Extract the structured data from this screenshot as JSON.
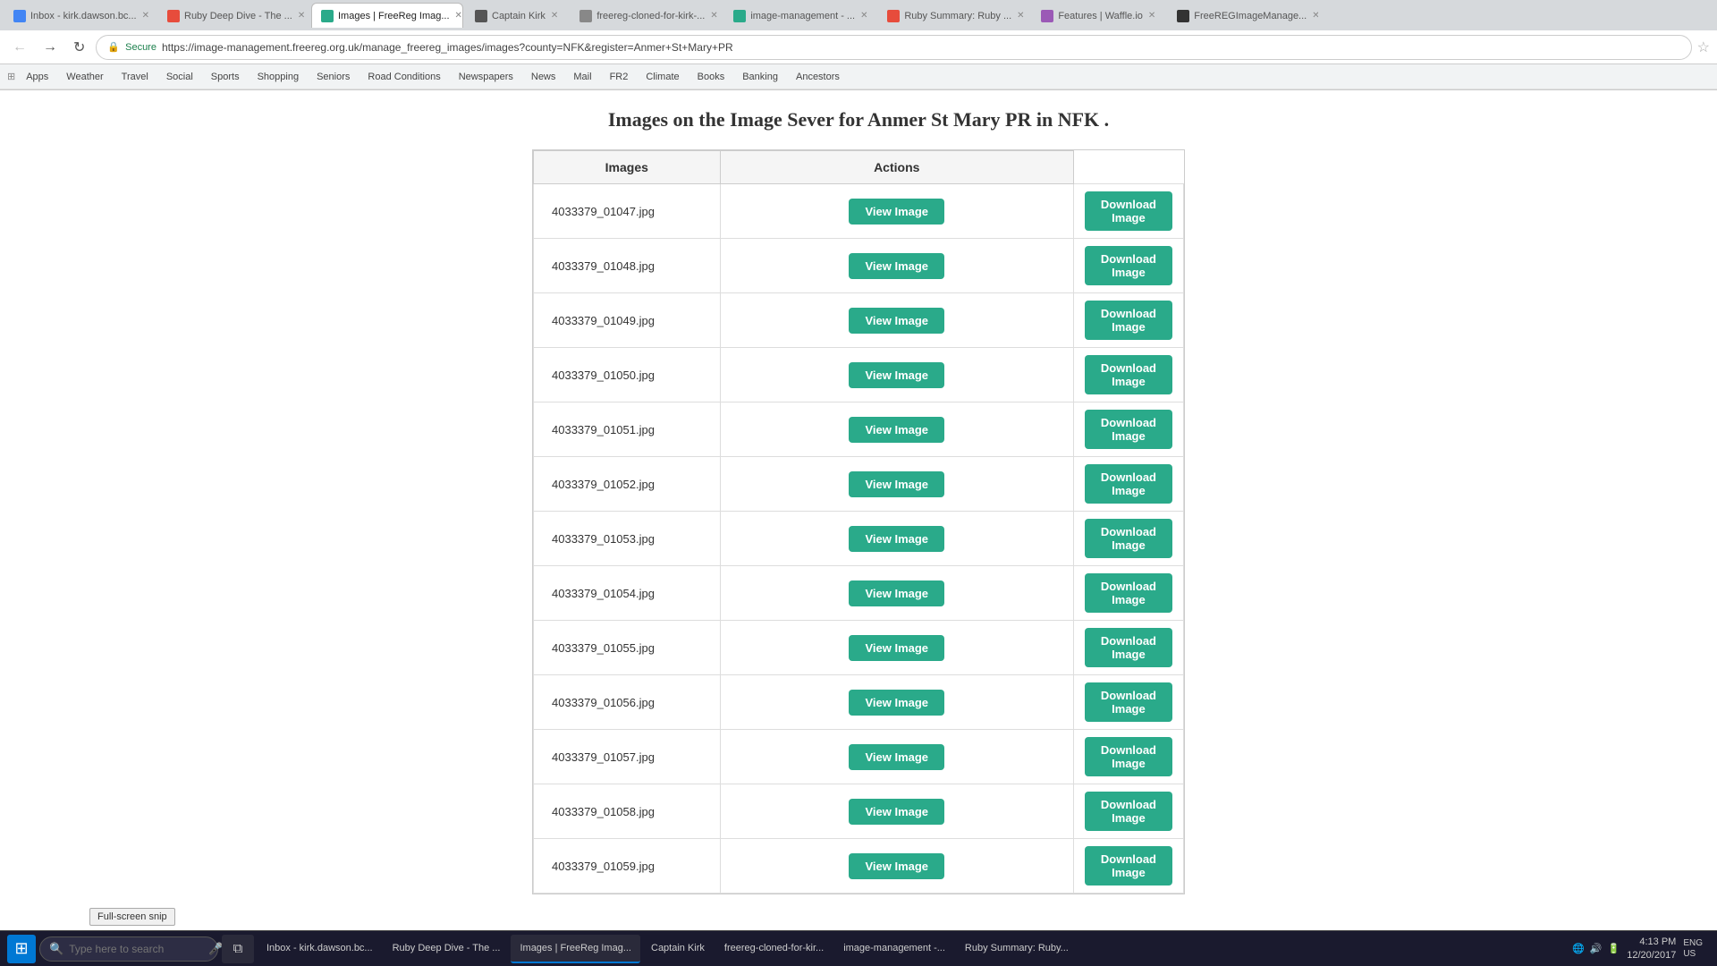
{
  "browser": {
    "tabs": [
      {
        "label": "Inbox - kirk.dawson.bc...",
        "active": false,
        "id": "inbox"
      },
      {
        "label": "Ruby Deep Dive - The ...",
        "active": false,
        "id": "ruby-deep"
      },
      {
        "label": "Images | FreeReg Imag...",
        "active": true,
        "id": "images"
      },
      {
        "label": "Captain Kirk",
        "active": false,
        "id": "captain"
      },
      {
        "label": "freereg-cloned-for-kirk-...",
        "active": false,
        "id": "freereg"
      },
      {
        "label": "image-management - ...",
        "active": false,
        "id": "imgmgmt"
      },
      {
        "label": "Ruby Summary: Ruby ...",
        "active": false,
        "id": "ruby-sum"
      },
      {
        "label": "Features | Waffle.io",
        "active": false,
        "id": "waffle"
      },
      {
        "label": "FreeREGImageManage...",
        "active": false,
        "id": "freeregiimg"
      }
    ],
    "address": "https://image-management.freereg.org.uk/manage_freereg_images/images?county=NFK&register=Anmer+St+Mary+PR",
    "bookmarks": [
      "Apps",
      "Weather",
      "Travel",
      "Social",
      "Sports",
      "Shopping",
      "Seniors",
      "Road Conditions",
      "Newspapers",
      "News",
      "Mail",
      "FR2",
      "Climate",
      "Books",
      "Banking",
      "Ancestors"
    ]
  },
  "page": {
    "title": "Images on the Image Sever for Anmer St Mary PR in NFK .",
    "table": {
      "headers": [
        "Images",
        "Actions"
      ],
      "columns": {
        "view_label": "View Image",
        "download_label": "Download Image"
      },
      "rows": [
        {
          "filename": "4033379_01047.jpg"
        },
        {
          "filename": "4033379_01048.jpg"
        },
        {
          "filename": "4033379_01049.jpg"
        },
        {
          "filename": "4033379_01050.jpg"
        },
        {
          "filename": "4033379_01051.jpg"
        },
        {
          "filename": "4033379_01052.jpg"
        },
        {
          "filename": "4033379_01053.jpg"
        },
        {
          "filename": "4033379_01054.jpg"
        },
        {
          "filename": "4033379_01055.jpg"
        },
        {
          "filename": "4033379_01056.jpg"
        },
        {
          "filename": "4033379_01057.jpg"
        },
        {
          "filename": "4033379_01058.jpg"
        },
        {
          "filename": "4033379_01059.jpg"
        }
      ]
    }
  },
  "taskbar": {
    "search_placeholder": "Type here to search",
    "items": [
      {
        "label": "Inbox - kirk.dawson.bc..."
      },
      {
        "label": "Ruby Deep Dive - The ..."
      },
      {
        "label": "Images | FreeReg Imag...",
        "active": true
      },
      {
        "label": "Captain Kirk"
      },
      {
        "label": "freereg-cloned-for-kir..."
      },
      {
        "label": "image-management -..."
      },
      {
        "label": "Ruby Summary: Ruby..."
      }
    ],
    "time": "4:13 PM",
    "date": "12/20/2017",
    "language": "ENG\nUS"
  },
  "tooltip": {
    "text": "Full-screen snip"
  }
}
